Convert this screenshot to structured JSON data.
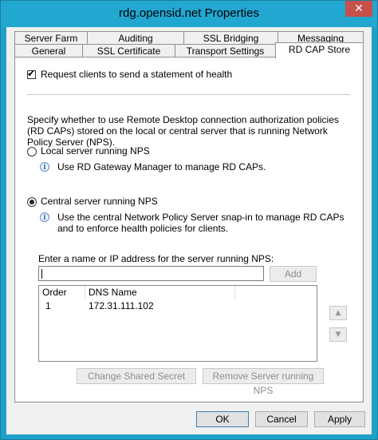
{
  "window": {
    "title": "rdg.opensid.net Properties",
    "close_glyph": "✕"
  },
  "tabs_row1": [
    {
      "label": "Server Farm"
    },
    {
      "label": "Auditing"
    },
    {
      "label": "SSL Bridging"
    },
    {
      "label": "Messaging"
    }
  ],
  "tabs_row2": [
    {
      "label": "General"
    },
    {
      "label": "SSL Certificate"
    },
    {
      "label": "Transport Settings"
    },
    {
      "label": "RD CAP Store",
      "active": true
    }
  ],
  "panel": {
    "health_checkbox": {
      "label": "Request clients to send a statement of health",
      "checked": true,
      "mark": "✔"
    },
    "description": "Specify whether to use Remote Desktop connection authorization policies (RD CAPs) stored on the local or central server that is running Network Policy Server (NPS).",
    "local_option": {
      "label": "Local server running NPS",
      "selected": false,
      "info": "Use RD Gateway Manager to manage RD CAPs."
    },
    "central_option": {
      "label": "Central server running NPS",
      "selected": true,
      "info": "Use the central Network Policy Server snap-in to manage RD CAPs and to enforce health policies for clients."
    },
    "info_glyph": "i",
    "server_input": {
      "label": "Enter a name or IP address for the server running NPS:",
      "value": ""
    },
    "add_button": "Add",
    "list": {
      "columns": [
        "Order",
        "DNS Name"
      ],
      "rows": [
        {
          "order": "1",
          "dns": "172.31.111.102"
        }
      ]
    },
    "up_glyph": "▲",
    "down_glyph": "▼",
    "change_secret_button": "Change Shared Secret",
    "remove_server_button": "Remove Server running NPS"
  },
  "footer": {
    "ok": "OK",
    "cancel": "Cancel",
    "apply": "Apply"
  }
}
